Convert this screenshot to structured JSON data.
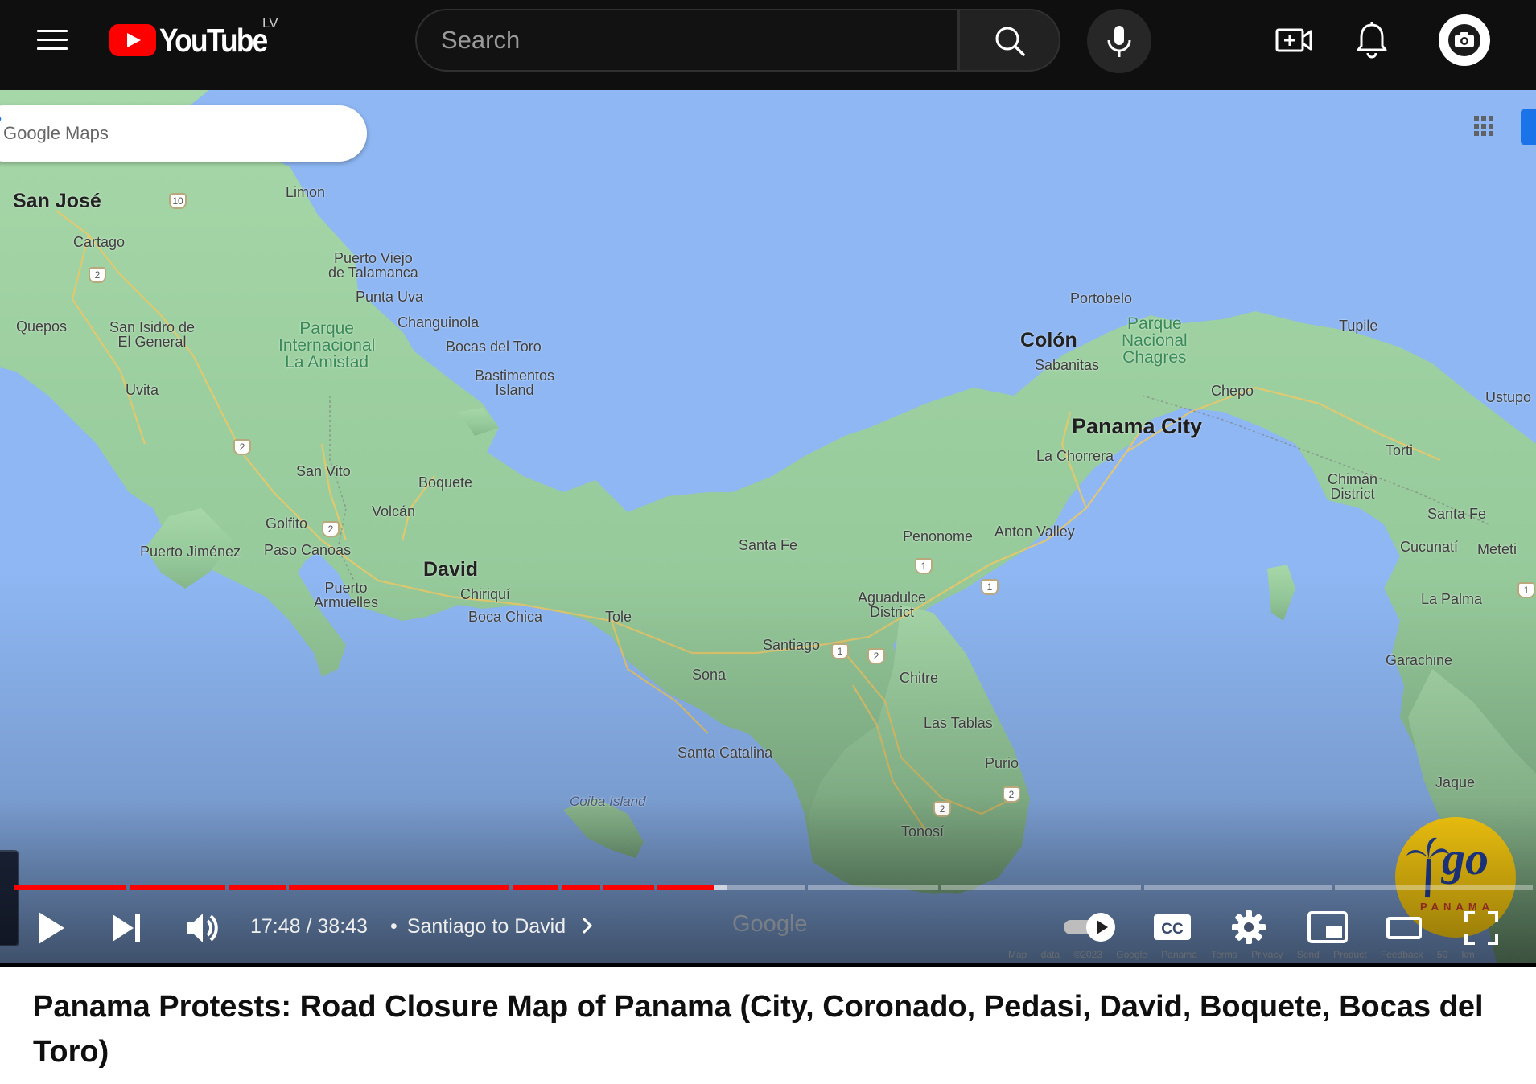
{
  "header": {
    "logo_text": "YouTube",
    "country_code": "LV",
    "search_placeholder": "Search"
  },
  "map": {
    "search_placeholder": "Google Maps",
    "watermark": "Google",
    "copyright_items": [
      "Map data ©2023 Google",
      "Panama",
      "Terms",
      "Privacy",
      "Send Product Feedback",
      "50 km"
    ],
    "labels": {
      "san_jose": "San José",
      "limon": "Limon",
      "cartago": "Cartago",
      "puerto_viejo": [
        "Puerto Viejo",
        "de Talamanca"
      ],
      "punta_uva": "Punta Uva",
      "quepos": "Quepos",
      "san_isidro": [
        "San Isidro de",
        "El General"
      ],
      "parque_amistad": [
        "Parque",
        "Internacional",
        "La Amistad"
      ],
      "changuinola": "Changuinola",
      "bocas_del_toro": "Bocas del Toro",
      "bastimentos": [
        "Bastimentos",
        "Island"
      ],
      "uvita": "Uvita",
      "san_vito": "San Vito",
      "boquete": "Boquete",
      "volcan": "Volcán",
      "golfito": "Golfito",
      "puerto_jimenez": "Puerto Jiménez",
      "paso_canoas": "Paso Canoas",
      "david": "David",
      "puerto_armuelles": [
        "Puerto",
        "Armuelles"
      ],
      "chiriqui": "Chiriquí",
      "boca_chica": "Boca Chica",
      "tole": "Tole",
      "santa_fe": "Santa Fe",
      "sona": "Sona",
      "santiago": "Santiago",
      "santa_catalina": "Santa Catalina",
      "coiba": "Coiba Island",
      "portobelo": "Portobelo",
      "parque_chagres": [
        "Parque",
        "Nacional",
        "Chagres"
      ],
      "colon": "Colón",
      "sabanitas": "Sabanitas",
      "panama_city": "Panama City",
      "la_chorrera": "La Chorrera",
      "chepo": "Chepo",
      "tupile": "Tupile",
      "ustupo": "Ustupo",
      "torti": "Torti",
      "chiman": [
        "Chimán",
        "District"
      ],
      "santa_fe_east": "Santa Fe",
      "cucunati": "Cucunatí",
      "meteti": "Meteti",
      "penonome": "Penonome",
      "anton_valley": "Anton Valley",
      "aguadulce": [
        "Aguadulce",
        "District"
      ],
      "chitre": "Chitre",
      "las_tablas": "Las Tablas",
      "purio": "Purio",
      "tonosi": "Tonosí",
      "la_palma": "La Palma",
      "garachine": "Garachine",
      "jaque": "Jaque"
    },
    "shields": {
      "s10": "10",
      "s2a": "2",
      "s2b": "2",
      "s2c": "2",
      "s1a": "1",
      "s1b": "1",
      "s1c": "1",
      "s2d": "2",
      "s2e": "2",
      "s2f": "2",
      "s1d": "1"
    },
    "channel_logo": {
      "word": "go",
      "sub": "PANAMA"
    }
  },
  "player": {
    "current_time": "17:48",
    "duration": "38:43",
    "time_display": "17:48 / 38:43",
    "chapter_title": "Santiago to David",
    "progress_fraction": 0.4597,
    "buffered_fraction": 0.468,
    "autoplay": true,
    "colors": {
      "played": "#ff0000",
      "buffered": "#bdbdbd",
      "track": "#8a8a8a"
    }
  },
  "video": {
    "title": "Panama Protests: Road Closure Map of Panama (City, Coronado, Pedasi, David, Boquete, Bocas del Toro)"
  },
  "icons": [
    "menu-icon",
    "youtube-logo-icon",
    "search-icon",
    "mic-icon",
    "create-video-icon",
    "bell-icon",
    "avatar-camera-icon",
    "maps-search-icon",
    "directions-icon",
    "apps-grid-icon",
    "play-icon",
    "next-icon",
    "volume-icon",
    "chevron-right-icon",
    "autoplay-toggle-icon",
    "captions-icon",
    "settings-gear-icon",
    "miniplayer-icon",
    "theater-icon",
    "fullscreen-icon"
  ]
}
